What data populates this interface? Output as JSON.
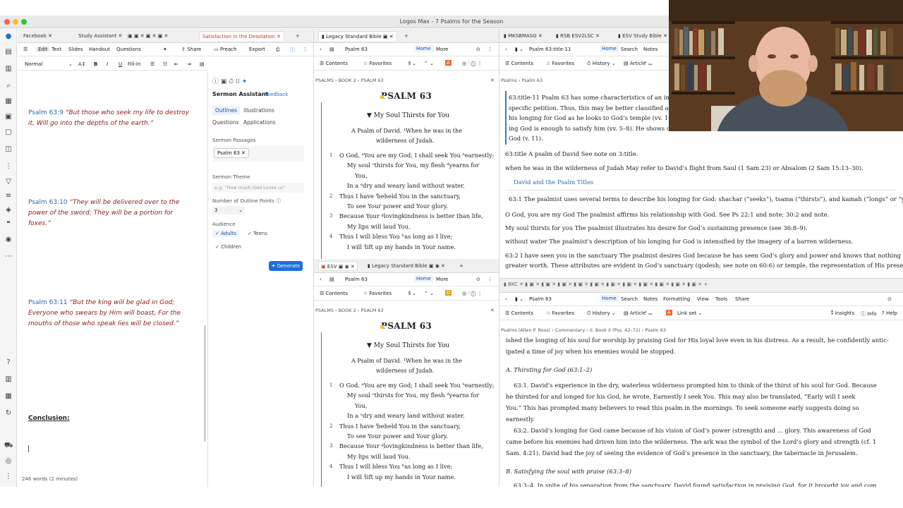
{
  "window_title": "Logos Max - 7 Psalms for the Season",
  "top_tabs_left": [
    "Facebook",
    "Study Assistant",
    "Satisfaction in the Desolation"
  ],
  "top_tabs_mid": [
    "Legacy Standard Bible"
  ],
  "top_tabs_right": [
    "MKSBMASG",
    "RSB ESV2LSC",
    "ESV Study Bible"
  ],
  "editor": {
    "menu": [
      "Edit",
      "Text",
      "Slides",
      "Handout",
      "Questions"
    ],
    "share": "Share",
    "preach": "Preach",
    "export": "Export",
    "style": "Normal",
    "fillin": "Fill-in",
    "sections": [
      {
        "ref": "Psalm 63:9",
        "text": "“But those who seek my life to destroy it, Will go into the depths of the earth.”"
      },
      {
        "ref": "Psalm 63:10",
        "text": "“They will be delivered over to the power of the sword; They will be a portion for foxes.”"
      },
      {
        "ref": "Psalm 63:11",
        "text": "“But the king will be glad in God; Everyone who swears by Him will boast, For the mouths of those who speak lies will be closed.”"
      }
    ],
    "conclusion": "Conclusion:",
    "wordcount": "246 words (2 minutes)"
  },
  "assistant": {
    "title": "Sermon Assistant",
    "feedback": "Feedback",
    "tabs": [
      "Outlines",
      "Illustrations",
      "Questions",
      "Applications"
    ],
    "passages_label": "Sermon Passages",
    "passage_chip": "Psalm 63",
    "theme_label": "Sermon Theme",
    "theme_placeholder": "e.g. “How much God Loves us”",
    "points_label": "Number of Outline Points",
    "points_value": "3",
    "audience_label": "Audience",
    "audience": [
      "Adults",
      "Teens",
      "Children"
    ],
    "generate": "Generate"
  },
  "bible": {
    "passage": "Psalm 63",
    "home": "Home",
    "more": "More",
    "contents": "Contents",
    "favorites": "Favorites",
    "breadcrumb": "PSALMS › BOOK 2 › PSALM 63",
    "heading": "PSALM 63",
    "subhead": "My Soul Thirsts for You",
    "superscript": [
      "A Psalm of David. ¹When he was in the",
      "wilderness of Judah."
    ],
    "lines": [
      {
        "v": "1",
        "t": "O God, ᵃYou are my God; I shall seek You ᵇearnestly;"
      },
      {
        "v": "",
        "t": "My soul ᶜthirsts for You, my flesh ᵈyearns for"
      },
      {
        "v": "",
        "t": "You,"
      },
      {
        "v": "",
        "t": "In a ᵉdry and weary land without water."
      },
      {
        "v": "2",
        "t": "Thus I have ᶠbeheld You in the sanctuary,"
      },
      {
        "v": "",
        "t": "To see Your power and Your glory."
      },
      {
        "v": "3",
        "t": "Because Your ᵍlovingkindness is better than life,"
      },
      {
        "v": "",
        "t": "My lips will laud You."
      },
      {
        "v": "4",
        "t": "Thus I will bless You ʰas long as I live;"
      },
      {
        "v": "",
        "t": "I will ⁱlift up my hands in Your name."
      }
    ],
    "tab_esv": "ESV",
    "tab_lsb": "Legacy Standard Bible"
  },
  "notes": {
    "passage": "Psalm 63:title-11",
    "home": "Home",
    "search": "Search",
    "notes": "Notes",
    "history": "History",
    "article": "Article",
    "breadcrumb": "Psalms › Psalm 63",
    "lines": [
      "63:title-11 Psalm 63 has some characteristics of an indivi",
      "specific petition. Thus, this may be better classified as a p",
      "his longing for God as he looks to God’s temple (vv. 1–2).",
      "ing God is enough to satisfy him (vv. 5–8). He shows co",
      "God (v. 11).",
      "63:title A psalm of David See note on 3:title.",
      "when he was in the wilderness of Judah May refer to David’s flight from Saul (1 Sam 23) or Absalom (2 Sam 15:13–30).",
      "David and the Psalm Titles",
      "63:1 The psalmist uses several terms to describe his longing for God: shachar (“seeks”), tsama (“thirsts”), and kamah (“longs” or “yearns”).",
      "O God, you are my God The psalmist affirms his relationship with God. See Ps 22:1 and note; 30:2 and note.",
      "My soul thirsts for you The psalmist illustrates his desire for God’s sustaining presence (see 36:8–9).",
      "without water The psalmist’s description of his longing for God is intensified by the imagery of a barren wilderness.",
      "63:2 I have seen you in the sanctuary The psalmist desires God because he has seen God’s glory and power and knows that nothing is of",
      "greater worth. These attributes are evident in God’s sanctuary (qodesh; see note on 60:6) or temple, the representation of His presence (see"
    ]
  },
  "commentary": {
    "passage": "Psalm 63",
    "home": "Home",
    "search": "Search",
    "notes": "Notes",
    "formatting": "Formatting",
    "view": "View",
    "tools": "Tools",
    "share": "Share",
    "contents": "Contents",
    "favorites": "Favorites",
    "history": "History",
    "article": "Article",
    "linkset": "Link set",
    "insights": "Insights",
    "info": "Info",
    "help": "Help",
    "breadcrumb": "Psalms (Allen P. Ross) › Commentary › II. Book II (Pss. 42–72) › Psalm 63",
    "lines": [
      "ished the longing of his soul for worship by praising God for His loyal love even in his distress. As a result, he confidently antic-",
      "ipated a time of joy when his enemies would be stopped.",
      "A. Thirsting for God (63:1–2)",
      "63:1. David’s experience in the dry, waterless wilderness prompted him to think of the thirst of his soul for God. Because",
      "he thirsted for and longed for his God, he wrote, Earnestly I seek You. This may also be translated, “Early will I seek",
      "You.” This has prompted many believers to read this psalm in the mornings. To seek someone early suggests doing so",
      "earnestly.",
      "63:2. David’s longing for God came because of his vision of God’s power (strength) and ... glory. This awareness of God",
      "came before his enemies had driven him into the wilderness. The ark was the symbol of the Lord’s glory and strength (cf. 1",
      "Sam. 4:21). David had the joy of seeing the evidence of God’s presence in the sanctuary, the tabernacle in Jerusalem.",
      "B. Satisfying the soul with praise (63:3–8)",
      "63:3–4. In spite of his separation from the sanctuary, David found satisfaction in praising God, for it brought joy and com"
    ]
  }
}
